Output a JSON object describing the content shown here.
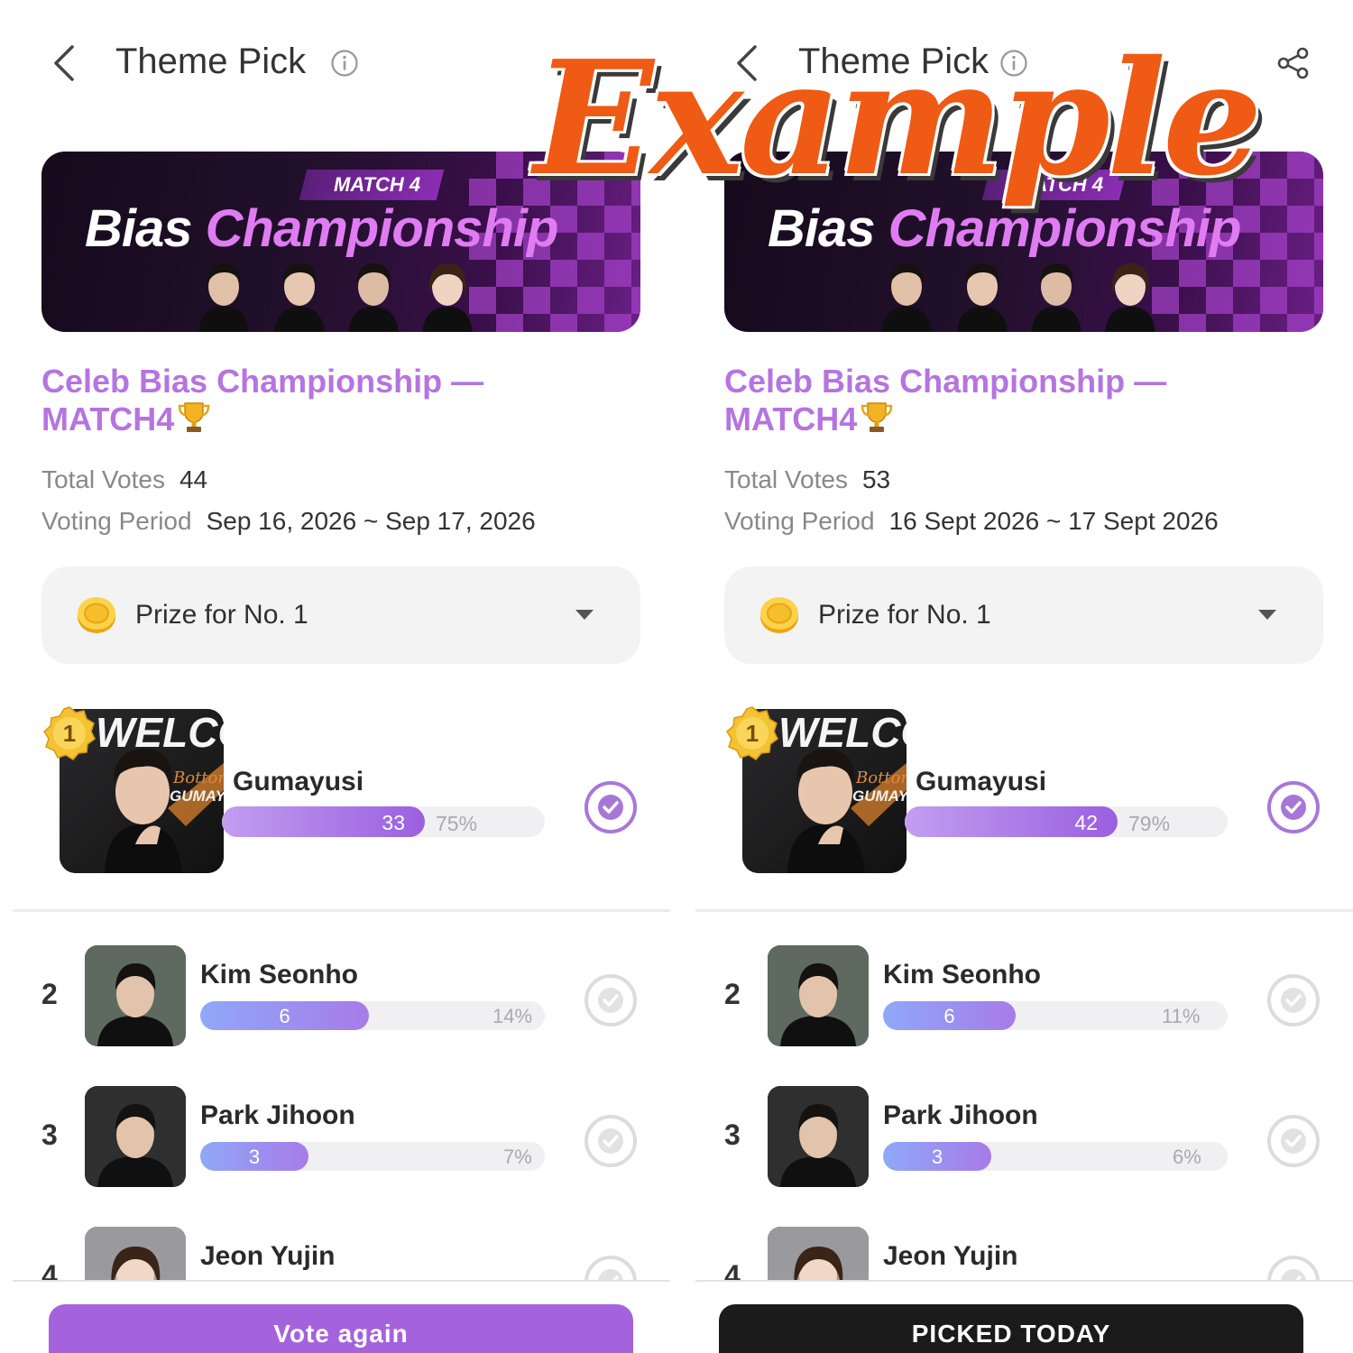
{
  "colors": {
    "accent": "#b574e0",
    "bar_top": "#9a5fe0",
    "bar_other": "#8fa8f8",
    "cta_vote": "#a463dc",
    "cta_picked": "#1b1b1b",
    "watermark": "#ef5a14"
  },
  "watermark": "Example",
  "panels": [
    {
      "header": {
        "title": "Theme Pick",
        "back_icon": "back-chevron-icon",
        "info_icon": "info-icon"
      },
      "banner": {
        "tag": "MATCH 4",
        "title_white": "Bias ",
        "title_pink": "Championship"
      },
      "event": {
        "title": "Celeb Bias Championship — MATCH4"
      },
      "meta": {
        "votes_label": "Total Votes",
        "votes_value": "44",
        "period_label": "Voting Period",
        "period_value": "Sep 16, 2026 ~ Sep 17, 2026"
      },
      "prize": {
        "label": "Prize for No. 1",
        "icon": "coin-icon"
      },
      "ranking": [
        {
          "rank": "1",
          "name": "Gumayusi",
          "votes": "33",
          "pct": "75%",
          "fraction": 0.75
        },
        {
          "rank": "2",
          "name": "Kim Seonho",
          "votes": "6",
          "pct": "14%",
          "fraction": 0.14
        },
        {
          "rank": "3",
          "name": "Park Jihoon",
          "votes": "3",
          "pct": "7%",
          "fraction": 0.07
        },
        {
          "rank": "4",
          "name": "Jeon Yujin"
        }
      ],
      "photo_caption": {
        "welcome": "WELCOME",
        "script": "Bottom",
        "name": "GUMAYUSI"
      },
      "cta": {
        "label": "Vote again",
        "style": "vote"
      }
    },
    {
      "header": {
        "title": "Theme Pick",
        "back_icon": "back-chevron-icon",
        "info_icon": "info-icon",
        "share_icon": "share-icon"
      },
      "banner": {
        "tag": "MATCH 4",
        "title_white": "Bias ",
        "title_pink": "Championship"
      },
      "event": {
        "title": "Celeb Bias Championship — MATCH4"
      },
      "meta": {
        "votes_label": "Total Votes",
        "votes_value": "53",
        "period_label": "Voting Period",
        "period_value": "16 Sept 2026 ~ 17 Sept 2026"
      },
      "prize": {
        "label": "Prize for No. 1",
        "icon": "coin-icon"
      },
      "ranking": [
        {
          "rank": "1",
          "name": "Gumayusi",
          "votes": "42",
          "pct": "79%",
          "fraction": 0.79
        },
        {
          "rank": "2",
          "name": "Kim Seonho",
          "votes": "6",
          "pct": "11%",
          "fraction": 0.11
        },
        {
          "rank": "3",
          "name": "Park Jihoon",
          "votes": "3",
          "pct": "6%",
          "fraction": 0.06
        },
        {
          "rank": "4",
          "name": "Jeon Yujin"
        }
      ],
      "photo_caption": {
        "welcome": "WELCOME",
        "script": "Bottom",
        "name": "GUMAYUSI"
      },
      "cta": {
        "label": "PICKED TODAY",
        "style": "picked"
      }
    }
  ]
}
